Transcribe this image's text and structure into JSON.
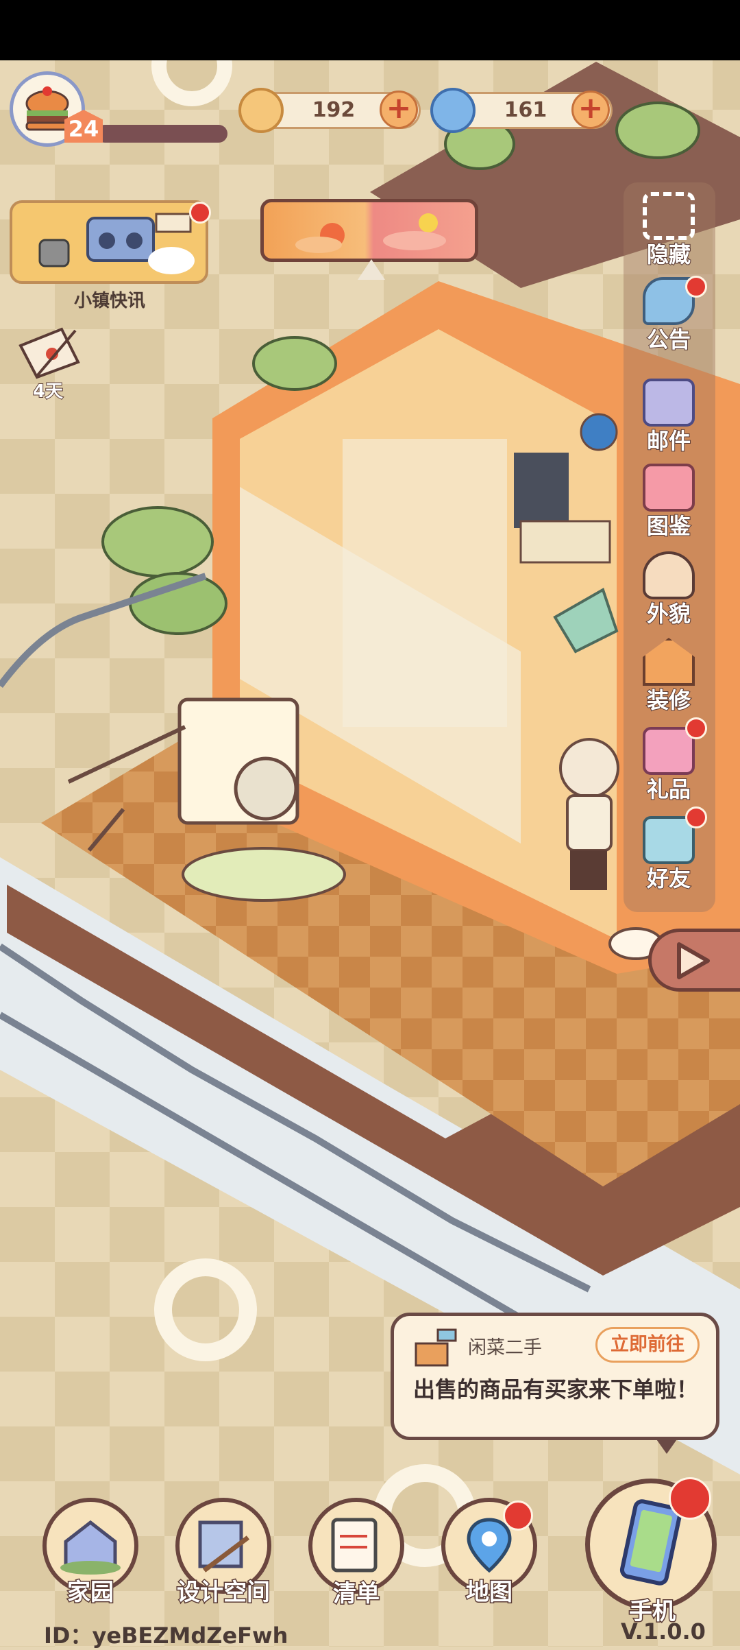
{
  "player": {
    "level": "24",
    "xp_progress": 0.0
  },
  "currencies": [
    {
      "name": "coins",
      "icon": "coin-icon",
      "value": "192"
    },
    {
      "name": "gems",
      "icon": "swirl-gem-icon",
      "value": "161"
    }
  ],
  "left_panel": {
    "news_label": "小镇快讯",
    "letter_label": "4天"
  },
  "right_menu": [
    {
      "key": "hide",
      "icon": "frame-icon",
      "label": "隐藏",
      "badge": false
    },
    {
      "key": "announcement",
      "icon": "megaphone-icon",
      "label": "公告",
      "badge": true
    },
    {
      "key": "mail",
      "icon": "envelope-icon",
      "label": "邮件",
      "badge": false
    },
    {
      "key": "collection",
      "icon": "book-icon",
      "label": "图鉴",
      "badge": false
    },
    {
      "key": "appearance",
      "icon": "character-face-icon",
      "label": "外貌",
      "badge": false
    },
    {
      "key": "decorate",
      "icon": "house-wrench-icon",
      "label": "装修",
      "badge": false
    },
    {
      "key": "gift",
      "icon": "gift-box-icon",
      "label": "礼品",
      "badge": true
    },
    {
      "key": "friends",
      "icon": "contacts-icon",
      "label": "好友",
      "badge": true
    }
  ],
  "notification": {
    "title": "闲菜二手",
    "action": "立即前往",
    "message": "出售的商品有买家来下单啦！"
  },
  "bottom_nav": [
    {
      "key": "home",
      "icon": "house-icon",
      "label": "家园",
      "badge": false
    },
    {
      "key": "design",
      "icon": "blueprint-icon",
      "label": "设计空间",
      "badge": false
    },
    {
      "key": "list",
      "icon": "checklist-icon",
      "label": "清单",
      "badge": false
    },
    {
      "key": "map",
      "icon": "map-pin-icon",
      "label": "地图",
      "badge": true
    },
    {
      "key": "phone",
      "icon": "phone-icon",
      "label": "手机",
      "badge": true
    }
  ],
  "footer": {
    "user_id": "ID：yeBEZMdZeFwh",
    "version": "V.1.0.0"
  },
  "colors": {
    "background": "#e6d6b4",
    "badge_red": "#e23a32",
    "wood_dark": "#6b463f",
    "accent_orange": "#de6a35"
  }
}
